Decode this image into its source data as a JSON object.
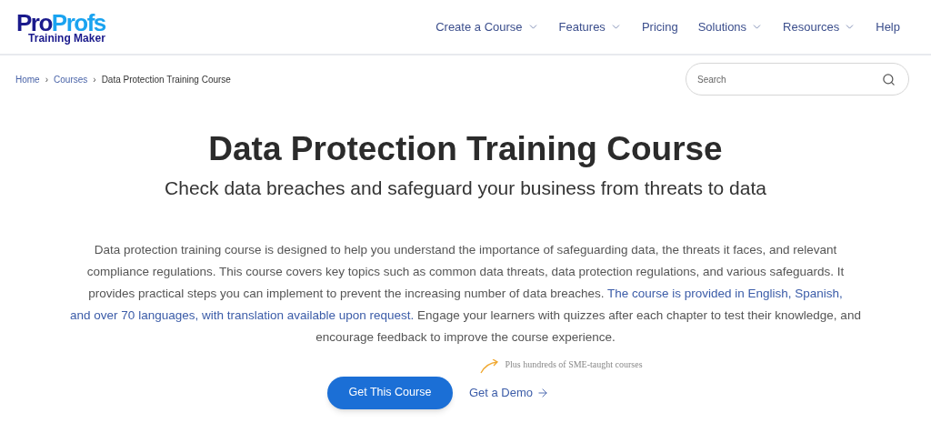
{
  "logo": {
    "brand_part1": "Pro",
    "brand_part2": "Profs",
    "product": "Training Maker"
  },
  "nav": [
    {
      "label": "Create a Course",
      "dropdown": true
    },
    {
      "label": "Features",
      "dropdown": true
    },
    {
      "label": "Pricing",
      "dropdown": false
    },
    {
      "label": "Solutions",
      "dropdown": true
    },
    {
      "label": "Resources",
      "dropdown": true
    },
    {
      "label": "Help",
      "dropdown": false
    }
  ],
  "breadcrumb": [
    {
      "label": "Home",
      "current": false
    },
    {
      "label": "Courses",
      "current": false
    },
    {
      "label": "Data Protection Training Course",
      "current": true
    }
  ],
  "breadcrumb_separator": "›",
  "search": {
    "placeholder": "Search"
  },
  "title": "Data Protection Training Course",
  "subtitle": "Check data breaches and safeguard your business from threats to data",
  "description": {
    "before": "Data protection training course is designed to help you understand the importance of safeguarding data, the threats it faces, and relevant compliance regulations. This course covers key topics such as common data threats, data protection regulations, and various safeguards. It provides practical steps you can implement to prevent the increasing number of data breaches.",
    "link_lines": [
      "The course is provided in English, Spanish,",
      "and over 70 languages, with translation available upon request."
    ],
    "after": "Engage your learners with quizzes after each chapter to test their knowledge, and encourage feedback to improve the course experience."
  },
  "note": "Plus hundreds of SME-taught courses",
  "primary_button": "Get This Course",
  "demo_link": "Get a Demo"
}
